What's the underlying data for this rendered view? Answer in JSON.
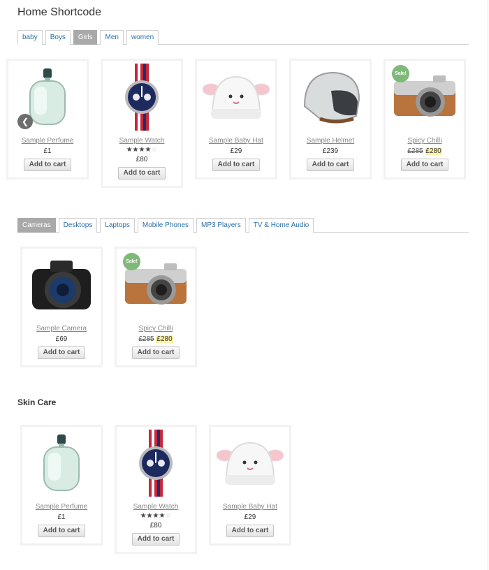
{
  "page_title": "Home Shortcode",
  "tabs1": [
    {
      "label": "baby",
      "active": false
    },
    {
      "label": "Boys",
      "active": false
    },
    {
      "label": "Girls",
      "active": true
    },
    {
      "label": "Men",
      "active": false
    },
    {
      "label": "women",
      "active": false
    }
  ],
  "carousel": {
    "prev_icon": "chevron-left-icon",
    "products": [
      {
        "name": "Sample Perfume",
        "price": "£1",
        "button": "Add to cart",
        "image": "perfume"
      },
      {
        "name": "Sample Watch",
        "rating": 4,
        "price": "£80",
        "button": "Add to cart",
        "image": "watch"
      },
      {
        "name": "Sample Baby Hat",
        "price": "£29",
        "button": "Add to cart",
        "image": "hat"
      },
      {
        "name": "Sample Helmet",
        "price": "£239",
        "button": "Add to cart",
        "image": "helmet"
      },
      {
        "name": "Spicy Chilli",
        "old_price": "£285",
        "new_price": "£280",
        "sale": "Sale!",
        "button": "Add to cart",
        "image": "camera-leica"
      }
    ]
  },
  "tabs2": [
    {
      "label": "Cameras",
      "active": true
    },
    {
      "label": "Desktops",
      "active": false
    },
    {
      "label": "Laptops",
      "active": false
    },
    {
      "label": "Mobile Phones",
      "active": false
    },
    {
      "label": "MP3 Players",
      "active": false
    },
    {
      "label": "TV & Home Audio",
      "active": false
    }
  ],
  "cameras": [
    {
      "name": "Sample Camera",
      "price": "£69",
      "button": "Add to cart",
      "image": "camera-dslr"
    },
    {
      "name": "Spicy Chilli",
      "old_price": "£285",
      "new_price": "£280",
      "sale": "Sale!",
      "button": "Add to cart",
      "image": "camera-leica"
    }
  ],
  "skin_care": {
    "heading": "Skin Care",
    "products": [
      {
        "name": "Sample Perfume",
        "price": "£1",
        "button": "Add to cart",
        "image": "perfume"
      },
      {
        "name": "Sample Watch",
        "rating": 4,
        "price": "£80",
        "button": "Add to cart",
        "image": "watch"
      },
      {
        "name": "Sample Baby Hat",
        "price": "£29",
        "button": "Add to cart",
        "image": "hat"
      }
    ]
  },
  "colors": {
    "link": "#2a6fa8",
    "active_tab": "#a9a9a9",
    "sale_badge": "#7fb979",
    "price_highlight": "#fff3a8"
  }
}
